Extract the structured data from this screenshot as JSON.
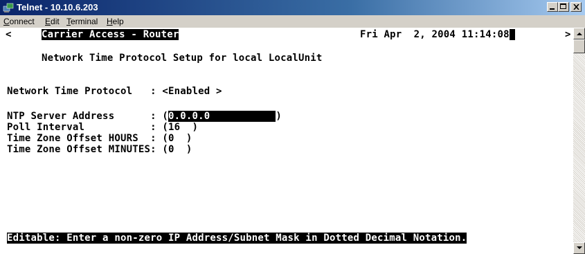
{
  "window": {
    "title": "Telnet - 10.10.6.203",
    "minimize_icon": "minimize-icon",
    "maximize_icon": "maximize-icon",
    "close_icon": "close-icon"
  },
  "menu": {
    "connect": "Connect",
    "edit": "Edit",
    "terminal": "Terminal",
    "help": "Help"
  },
  "terminal": {
    "left_marker": "<",
    "product": "Carrier Access - Router",
    "datetime": "Fri Apr  2, 2004 11:14:08",
    "right_marker": ">",
    "screen_title": "Network Time Protocol Setup for local LocalUnit",
    "fields": [
      {
        "label": "Network Time Protocol   : ",
        "value": "<Enabled >"
      },
      {
        "label": "NTP Server Address      : ",
        "value_prefix": "(",
        "value": "0.0.0.0",
        "value_pad": "           ",
        "value_suffix": ")"
      },
      {
        "label": "Poll Interval           : ",
        "value": "(16  )"
      },
      {
        "label": "Time Zone Offset HOURS  : ",
        "value": "(0  )"
      },
      {
        "label": "Time Zone Offset MINUTES: ",
        "value": "(0  )"
      }
    ],
    "status": "Editable: Enter a non-zero IP Address/Subnet Mask in Dotted Decimal Notation."
  },
  "colors": {
    "title_active": "#0a246a",
    "terminal_bg": "#ffffff",
    "terminal_fg": "#000000"
  }
}
